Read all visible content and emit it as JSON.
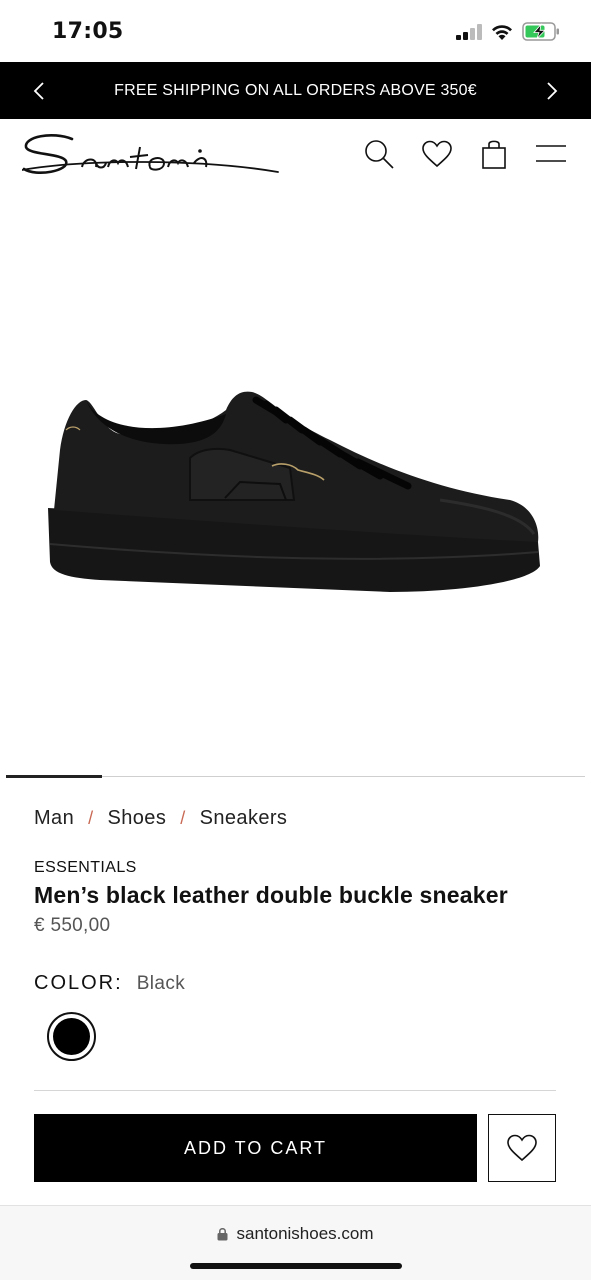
{
  "status_bar": {
    "time": "17:05"
  },
  "promo": {
    "text": "FREE SHIPPING ON ALL ORDERS ABOVE 350€"
  },
  "header": {
    "brand": "Santoni"
  },
  "breadcrumb": {
    "items": [
      "Man",
      "Shoes",
      "Sneakers"
    ],
    "separator": "/"
  },
  "product": {
    "collection": "ESSENTIALS",
    "title": "Men’s black leather double buckle sneaker",
    "price": "€ 550,00",
    "color_label": "COLOR:",
    "color_value": "Black",
    "swatch_color": "#000000"
  },
  "actions": {
    "add_to_cart": "ADD TO CART"
  },
  "browser": {
    "url": "santonishoes.com"
  },
  "icons": [
    "chevron-left-icon",
    "chevron-right-icon",
    "search-icon",
    "heart-icon",
    "shopping-bag-icon",
    "menu-icon",
    "lock-icon"
  ]
}
